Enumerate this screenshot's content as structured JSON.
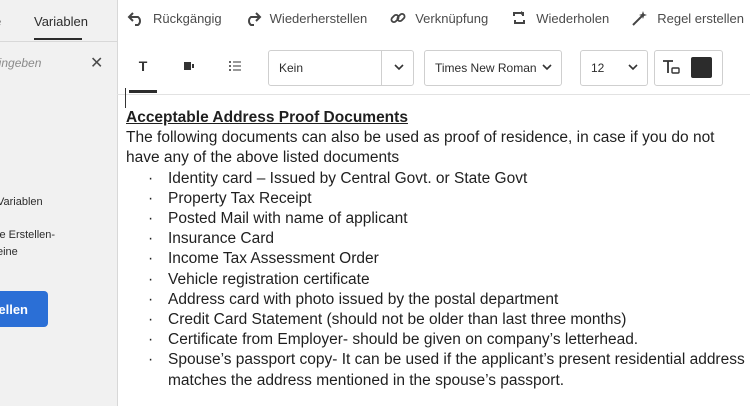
{
  "sidebar": {
    "tabs": [
      {
        "label": "e"
      },
      {
        "label": "Variablen"
      }
    ],
    "search_placeholder": "eingeben",
    "lines": [
      "Variablen",
      "ie Erstellen-",
      "eine"
    ],
    "button_label": "ellen"
  },
  "toolbar": {
    "undo": "Rückgängig",
    "redo": "Wiederherstellen",
    "link": "Verknüpfung",
    "repeat": "Wiederholen",
    "create_rule": "Regel erstellen"
  },
  "format": {
    "paragraph_style": "Kein",
    "font": "Times New Roman",
    "size": "12",
    "text_color": "#2c2c2c"
  },
  "document": {
    "title": "Acceptable Address Proof Documents",
    "intro": "The following documents can also be used as proof of residence, in case if you do not have any of the above listed documents",
    "bullet_char": "·",
    "items": [
      "Identity card – Issued by Central Govt. or State Govt",
      "Property Tax Receipt",
      "Posted Mail with name of applicant",
      "Insurance Card",
      "Income Tax Assessment Order",
      "Vehicle registration certificate",
      "Address card with photo issued by the postal department",
      "Credit Card Statement (should not be older than last three months)",
      "Certificate from Employer- should be given on company’s letterhead.",
      "Spouse’s passport copy- It can be used if the applicant’s present residential address"
    ],
    "last_item_continuation": "matches the address mentioned in the spouse’s passport."
  }
}
